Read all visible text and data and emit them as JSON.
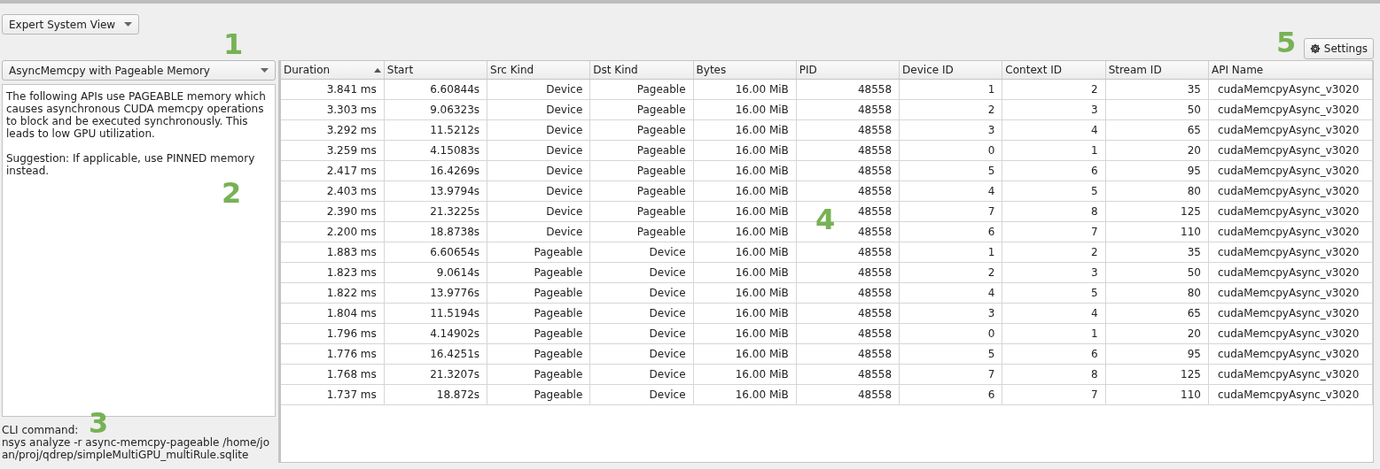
{
  "view_selector": {
    "value": "Expert System View"
  },
  "settings_button": {
    "label": "Settings"
  },
  "rule_selector": {
    "value": "AsyncMemcpy with Pageable Memory"
  },
  "description": {
    "paragraphs": [
      "The following APIs use PAGEABLE memory which causes asynchronous CUDA memcpy operations to block and be executed synchronously. This leads to low GPU utilization.",
      "Suggestion: If applicable, use PINNED memory instead."
    ]
  },
  "cli": {
    "label": "CLI command:",
    "command": "nsys analyze -r async-memcpy-pageable /home/joan/proj/qdrep/simpleMultiGPU_multiRule.sqlite"
  },
  "table": {
    "columns": [
      {
        "label": "Duration",
        "sorted": true
      },
      {
        "label": "Start",
        "sorted": false
      },
      {
        "label": "Src Kind",
        "sorted": false
      },
      {
        "label": "Dst Kind",
        "sorted": false
      },
      {
        "label": "Bytes",
        "sorted": false
      },
      {
        "label": "PID",
        "sorted": false
      },
      {
        "label": "Device ID",
        "sorted": false
      },
      {
        "label": "Context ID",
        "sorted": false
      },
      {
        "label": "Stream ID",
        "sorted": false
      },
      {
        "label": "API Name",
        "sorted": false
      }
    ],
    "rows": [
      [
        "3.841 ms",
        "6.60844s",
        "Device",
        "Pageable",
        "16.00 MiB",
        "48558",
        "1",
        "2",
        "35",
        "cudaMemcpyAsync_v3020"
      ],
      [
        "3.303 ms",
        "9.06323s",
        "Device",
        "Pageable",
        "16.00 MiB",
        "48558",
        "2",
        "3",
        "50",
        "cudaMemcpyAsync_v3020"
      ],
      [
        "3.292 ms",
        "11.5212s",
        "Device",
        "Pageable",
        "16.00 MiB",
        "48558",
        "3",
        "4",
        "65",
        "cudaMemcpyAsync_v3020"
      ],
      [
        "3.259 ms",
        "4.15083s",
        "Device",
        "Pageable",
        "16.00 MiB",
        "48558",
        "0",
        "1",
        "20",
        "cudaMemcpyAsync_v3020"
      ],
      [
        "2.417 ms",
        "16.4269s",
        "Device",
        "Pageable",
        "16.00 MiB",
        "48558",
        "5",
        "6",
        "95",
        "cudaMemcpyAsync_v3020"
      ],
      [
        "2.403 ms",
        "13.9794s",
        "Device",
        "Pageable",
        "16.00 MiB",
        "48558",
        "4",
        "5",
        "80",
        "cudaMemcpyAsync_v3020"
      ],
      [
        "2.390 ms",
        "21.3225s",
        "Device",
        "Pageable",
        "16.00 MiB",
        "48558",
        "7",
        "8",
        "125",
        "cudaMemcpyAsync_v3020"
      ],
      [
        "2.200 ms",
        "18.8738s",
        "Device",
        "Pageable",
        "16.00 MiB",
        "48558",
        "6",
        "7",
        "110",
        "cudaMemcpyAsync_v3020"
      ],
      [
        "1.883 ms",
        "6.60654s",
        "Pageable",
        "Device",
        "16.00 MiB",
        "48558",
        "1",
        "2",
        "35",
        "cudaMemcpyAsync_v3020"
      ],
      [
        "1.823 ms",
        "9.0614s",
        "Pageable",
        "Device",
        "16.00 MiB",
        "48558",
        "2",
        "3",
        "50",
        "cudaMemcpyAsync_v3020"
      ],
      [
        "1.822 ms",
        "13.9776s",
        "Pageable",
        "Device",
        "16.00 MiB",
        "48558",
        "4",
        "5",
        "80",
        "cudaMemcpyAsync_v3020"
      ],
      [
        "1.804 ms",
        "11.5194s",
        "Pageable",
        "Device",
        "16.00 MiB",
        "48558",
        "3",
        "4",
        "65",
        "cudaMemcpyAsync_v3020"
      ],
      [
        "1.796 ms",
        "4.14902s",
        "Pageable",
        "Device",
        "16.00 MiB",
        "48558",
        "0",
        "1",
        "20",
        "cudaMemcpyAsync_v3020"
      ],
      [
        "1.776 ms",
        "16.4251s",
        "Pageable",
        "Device",
        "16.00 MiB",
        "48558",
        "5",
        "6",
        "95",
        "cudaMemcpyAsync_v3020"
      ],
      [
        "1.768 ms",
        "21.3207s",
        "Pageable",
        "Device",
        "16.00 MiB",
        "48558",
        "7",
        "8",
        "125",
        "cudaMemcpyAsync_v3020"
      ],
      [
        "1.737 ms",
        "18.872s",
        "Pageable",
        "Device",
        "16.00 MiB",
        "48558",
        "6",
        "7",
        "110",
        "cudaMemcpyAsync_v3020"
      ]
    ]
  },
  "callouts": [
    "1",
    "2",
    "3",
    "4",
    "5"
  ]
}
